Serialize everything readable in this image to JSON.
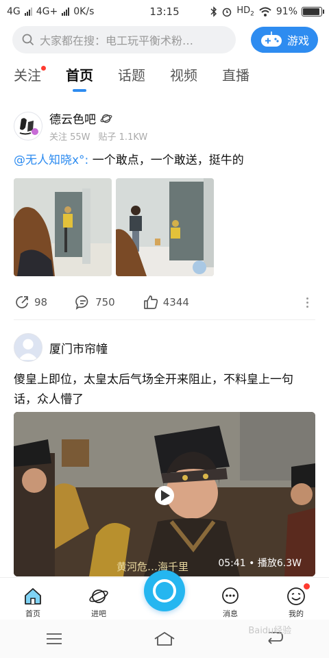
{
  "status_bar": {
    "network1": "4G",
    "network2": "4G+",
    "speed": "0K/s",
    "time": "13:15",
    "hd": "HD",
    "hd_sub": "2",
    "battery": "91%",
    "battery_level": 0.91
  },
  "search": {
    "placeholder": "大家都在搜：电工玩平衡术粉…",
    "game_button_label": "游戏"
  },
  "tabs": [
    {
      "label": "关注",
      "has_dot": true
    },
    {
      "label": "首页",
      "active": true
    },
    {
      "label": "话题"
    },
    {
      "label": "视频"
    },
    {
      "label": "直播"
    }
  ],
  "post1": {
    "forum_name": "德云色吧",
    "followers": "关注 55W",
    "posts": "贴子 1.1KW",
    "mention": "@无人知晓x°:",
    "text": " 一个敢点，一个敢送，挺牛的",
    "share_count": "98",
    "comment_count": "750",
    "like_count": "4344"
  },
  "post2": {
    "user_name": "厦门市帘幢",
    "text": "傻皇上即位，太皇太后气场全开来阻止，不料皇上一句话，众人懵了",
    "video_duration": "05:41",
    "video_plays": "播放6.3W",
    "subtitle": "黄河危…海千里"
  },
  "bottom_nav": [
    {
      "label": "首页",
      "icon": "home-icon"
    },
    {
      "label": "进吧",
      "icon": "planet-icon"
    },
    {
      "label": "消息",
      "icon": "message-icon"
    },
    {
      "label": "我的",
      "icon": "smile-icon",
      "has_dot": true
    }
  ],
  "watermark": "Baidu经验"
}
